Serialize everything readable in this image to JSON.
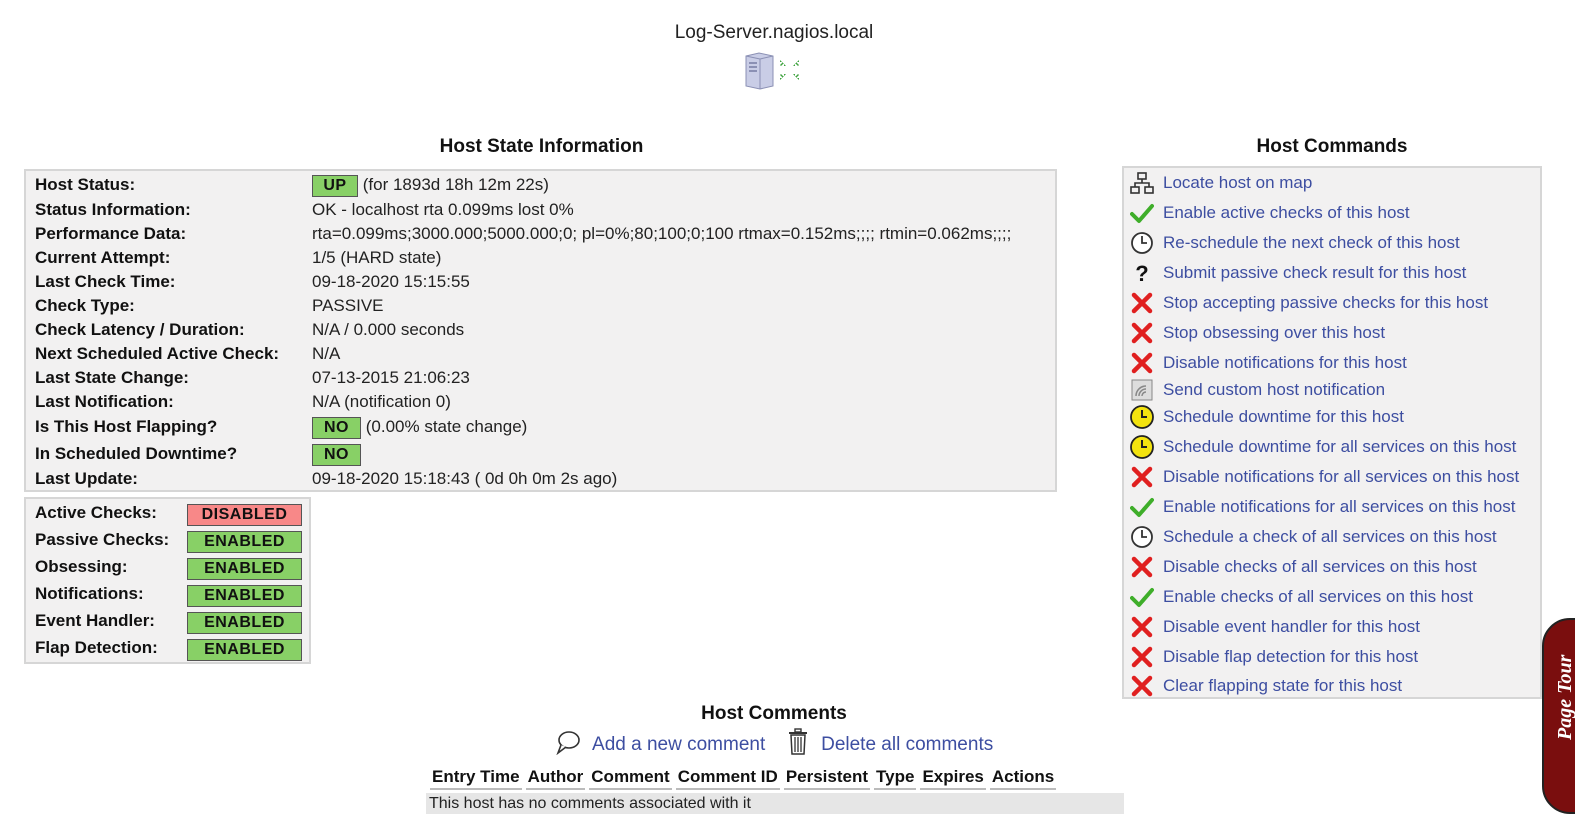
{
  "host": {
    "name": "Log-Server.nagios.local",
    "logo_icon": "server-icon"
  },
  "state_info": {
    "title": "Host State Information",
    "rows": [
      {
        "label": "Host Status:",
        "badge": "UP",
        "value": "(for 1893d 18h 12m 22s)"
      },
      {
        "label": "Status Information:",
        "value": "OK - localhost rta 0.099ms lost 0%"
      },
      {
        "label": "Performance Data:",
        "value": "rta=0.099ms;3000.000;5000.000;0; pl=0%;80;100;0;100 rtmax=0.152ms;;;; rtmin=0.062ms;;;;"
      },
      {
        "label": "Current Attempt:",
        "value": "1/5  (HARD state)"
      },
      {
        "label": "Last Check Time:",
        "value": "09-18-2020 15:15:55"
      },
      {
        "label": "Check Type:",
        "value": "PASSIVE"
      },
      {
        "label": "Check Latency / Duration:",
        "value": "N/A / 0.000 seconds"
      },
      {
        "label": "Next Scheduled Active Check:",
        "value": "N/A"
      },
      {
        "label": "Last State Change:",
        "value": "07-13-2015 21:06:23"
      },
      {
        "label": "Last Notification:",
        "value": "N/A (notification 0)"
      },
      {
        "label": "Is This Host Flapping?",
        "badge": "NO",
        "value": "(0.00% state change)"
      },
      {
        "label": "In Scheduled Downtime?",
        "badge": "NO",
        "value": ""
      },
      {
        "label": "Last Update:",
        "value": "09-18-2020 15:18:43  ( 0d 0h 0m 2s ago)"
      }
    ]
  },
  "toggles": [
    {
      "label": "Active Checks:",
      "state": "DISABLED"
    },
    {
      "label": "Passive Checks:",
      "state": "ENABLED"
    },
    {
      "label": "Obsessing:",
      "state": "ENABLED"
    },
    {
      "label": "Notifications:",
      "state": "ENABLED"
    },
    {
      "label": "Event Handler:",
      "state": "ENABLED"
    },
    {
      "label": "Flap Detection:",
      "state": "ENABLED"
    }
  ],
  "commands": {
    "title": "Host Commands",
    "items": [
      {
        "label": "Locate host on map",
        "icon": "map-icon"
      },
      {
        "label": "Enable active checks of this host",
        "icon": "checkmark-icon"
      },
      {
        "label": "Re-schedule the next check of this host",
        "icon": "clock-icon"
      },
      {
        "label": "Submit passive check result for this host",
        "icon": "question-icon"
      },
      {
        "label": "Stop accepting passive checks for this host",
        "icon": "cross-icon"
      },
      {
        "label": "Stop obsessing over this host",
        "icon": "cross-icon"
      },
      {
        "label": "Disable notifications for this host",
        "icon": "cross-icon"
      },
      {
        "label": "Send custom host notification",
        "icon": "notification-icon"
      },
      {
        "label": "Schedule downtime for this host",
        "icon": "downtime-clock-icon"
      },
      {
        "label": "Schedule downtime for all services on this host",
        "icon": "downtime-clock-icon"
      },
      {
        "label": "Disable notifications for all services on this host",
        "icon": "cross-icon"
      },
      {
        "label": "Enable notifications for all services on this host",
        "icon": "checkmark-icon"
      },
      {
        "label": "Schedule a check of all services on this host",
        "icon": "clock-icon"
      },
      {
        "label": "Disable checks of all services on this host",
        "icon": "cross-icon"
      },
      {
        "label": "Enable checks of all services on this host",
        "icon": "checkmark-icon"
      },
      {
        "label": "Disable event handler for this host",
        "icon": "cross-icon"
      },
      {
        "label": "Disable flap detection for this host",
        "icon": "cross-icon"
      },
      {
        "label": "Clear flapping state for this host",
        "icon": "cross-icon"
      }
    ]
  },
  "comments": {
    "title": "Host Comments",
    "add_label": "Add a new comment",
    "delete_label": "Delete all comments",
    "columns": [
      "Entry Time",
      "Author",
      "Comment",
      "Comment ID",
      "Persistent",
      "Type",
      "Expires",
      "Actions"
    ],
    "empty_message": "This host has no comments associated with it"
  },
  "page_tour": {
    "label": "Page Tour"
  },
  "colors": {
    "ok_green": "#88d066",
    "disabled_red": "#f88888",
    "link_blue": "#3d4ea1",
    "panel_bg": "#f2f1f1",
    "tour_bg": "#7a0e0e"
  }
}
